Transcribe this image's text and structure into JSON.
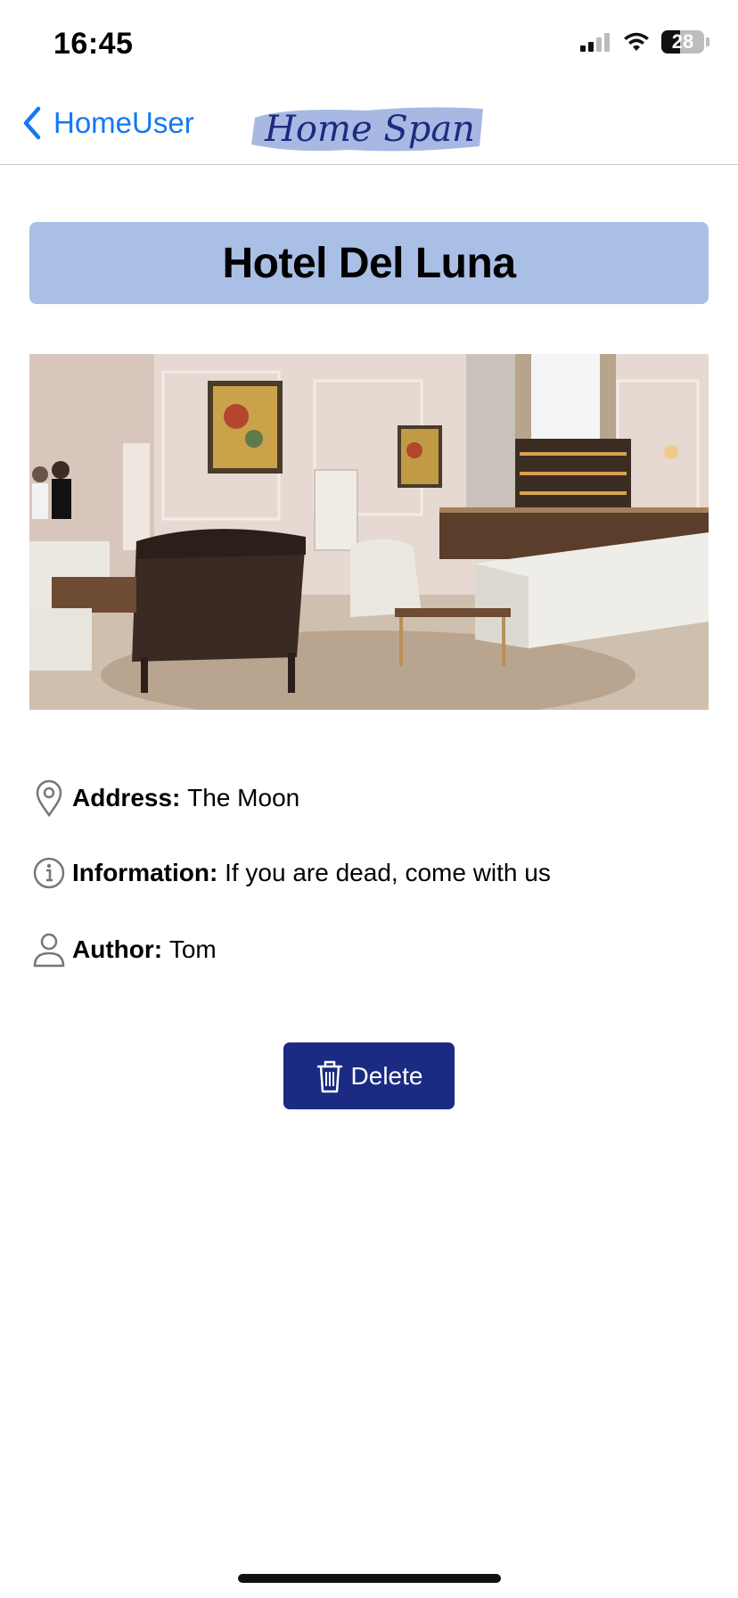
{
  "status_bar": {
    "time": "16:45",
    "battery": "28"
  },
  "nav": {
    "back_label": "HomeUser",
    "logo_text": "Home Span"
  },
  "listing": {
    "title": "Hotel Del Luna",
    "address_label": "Address:",
    "address_value": "The Moon",
    "info_label": "Information:",
    "info_value": "If you are dead, come with us",
    "author_label": "Author:",
    "author_value": "Tom"
  },
  "actions": {
    "delete_label": "Delete"
  },
  "colors": {
    "accent_blue": "#1479f0",
    "title_bg": "#a9bfe6",
    "delete_bg": "#1b2a82",
    "logo_text": "#1d2a80",
    "logo_brush": "#a7b9e2"
  },
  "icons": [
    "chevron-left-icon",
    "signal-icon",
    "wifi-icon",
    "battery-icon",
    "location-pin-icon",
    "info-circle-icon",
    "person-icon",
    "trash-icon"
  ]
}
